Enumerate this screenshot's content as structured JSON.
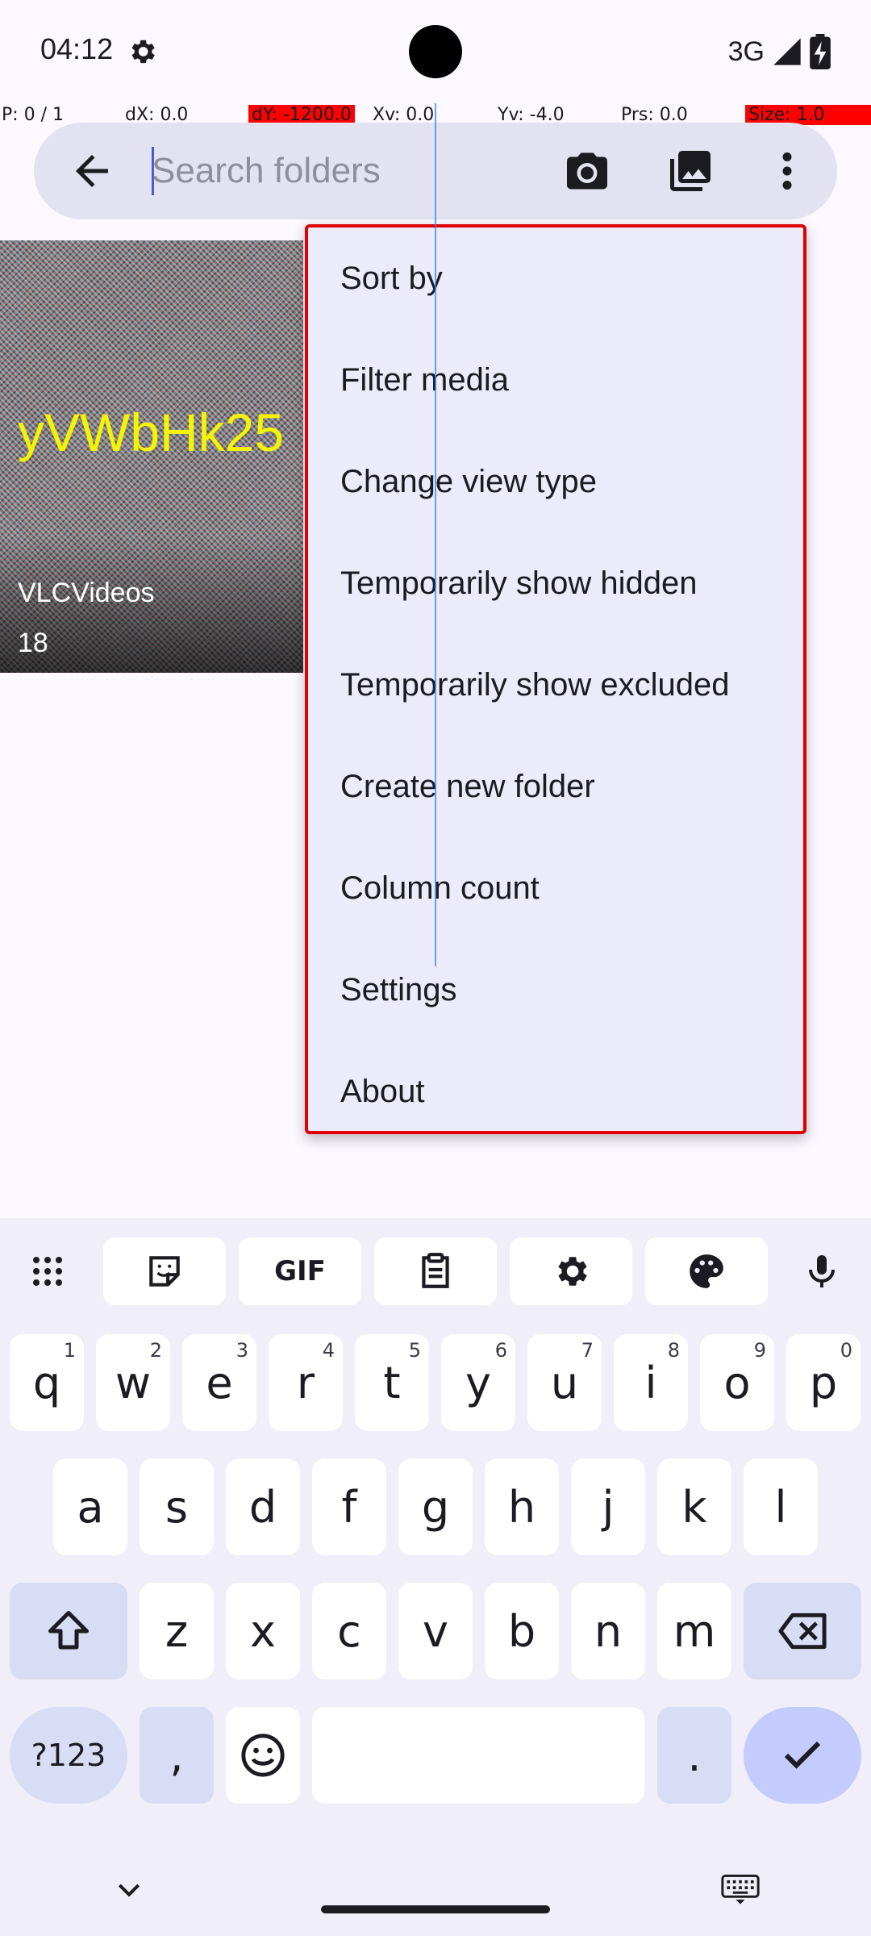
{
  "status_bar": {
    "time": "04:12",
    "network": "3G",
    "icons": [
      "settings-gear-icon",
      "cell-signal-icon",
      "battery-charging-icon"
    ]
  },
  "debug_overlay": {
    "pointer": "P: 0 / 1",
    "dx": "dX: 0.0",
    "dy": "dY: -1200.0",
    "xv": "Xv: 0.0",
    "yv": "Yv: -4.0",
    "prs": "Prs: 0.0",
    "size": "Size: 1.0"
  },
  "search": {
    "placeholder": "Search folders",
    "value": "",
    "icons": [
      "back-arrow-icon",
      "camera-icon",
      "gallery-icon",
      "more-vert-icon"
    ]
  },
  "folders": [
    {
      "name": "VLCVideos",
      "count": "18",
      "thumbnail_text": "yVWbHk25"
    }
  ],
  "menu": {
    "items": [
      "Sort by",
      "Filter media",
      "Change view type",
      "Temporarily show hidden",
      "Temporarily show excluded",
      "Create new folder",
      "Column count",
      "Settings",
      "About"
    ]
  },
  "keyboard": {
    "toolbar_icons": [
      "apps-grid-icon",
      "sticker-icon",
      "gif-icon",
      "clipboard-icon",
      "settings-icon",
      "palette-icon",
      "mic-icon"
    ],
    "gif_label": "GIF",
    "row1": [
      {
        "k": "q",
        "h": "1"
      },
      {
        "k": "w",
        "h": "2"
      },
      {
        "k": "e",
        "h": "3"
      },
      {
        "k": "r",
        "h": "4"
      },
      {
        "k": "t",
        "h": "5"
      },
      {
        "k": "y",
        "h": "6"
      },
      {
        "k": "u",
        "h": "7"
      },
      {
        "k": "i",
        "h": "8"
      },
      {
        "k": "o",
        "h": "9"
      },
      {
        "k": "p",
        "h": "0"
      }
    ],
    "row2": [
      "a",
      "s",
      "d",
      "f",
      "g",
      "h",
      "j",
      "k",
      "l"
    ],
    "row3": [
      "z",
      "x",
      "c",
      "v",
      "b",
      "n",
      "m"
    ],
    "symbols_label": "?123",
    "comma": ",",
    "period": "."
  },
  "colors": {
    "accent": "#4a5bd4",
    "menu_background": "#ebebfa",
    "menu_border": "#e00000",
    "debug_highlight": "#ff0000"
  }
}
